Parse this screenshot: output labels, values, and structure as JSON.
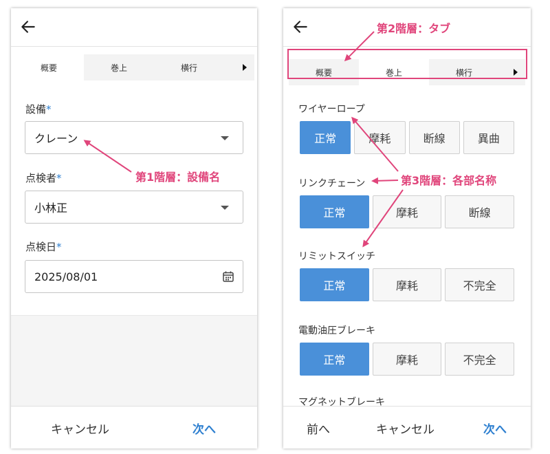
{
  "left": {
    "tabs": [
      "概要",
      "巻上",
      "横行"
    ],
    "fields": [
      {
        "label": "設備",
        "required_mark": "*",
        "value": "クレーン"
      },
      {
        "label": "点検者",
        "required_mark": "*",
        "value": "小林正"
      },
      {
        "label": "点検日",
        "required_mark": "*",
        "value": "2025/08/01"
      }
    ],
    "footer": {
      "cancel": "キャンセル",
      "next": "次へ"
    }
  },
  "right": {
    "tabs": [
      "概要",
      "巻上",
      "横行"
    ],
    "parts": [
      {
        "name": "ワイヤーロープ",
        "options": [
          "正常",
          "摩耗",
          "断線",
          "異曲"
        ],
        "selected": "正常"
      },
      {
        "name": "リンクチェーン",
        "options": [
          "正常",
          "摩耗",
          "断線"
        ],
        "selected": "正常"
      },
      {
        "name": "リミットスイッチ",
        "options": [
          "正常",
          "摩耗",
          "不完全"
        ],
        "selected": "正常"
      },
      {
        "name": "電動油圧ブレーキ",
        "options": [
          "正常",
          "摩耗",
          "不完全"
        ],
        "selected": "正常"
      }
    ],
    "cutoff_item": "マグネットブレーキ",
    "footer": {
      "prev": "前へ",
      "cancel": "キャンセル",
      "next": "次へ"
    }
  },
  "annotations": {
    "level1": "第1階層：設備名",
    "level2": "第2階層：タブ",
    "level3": "第3階層：各部名称"
  },
  "colors": {
    "accent": "#4a90d9",
    "link": "#2f80d0",
    "annotation": "#e0457b"
  }
}
